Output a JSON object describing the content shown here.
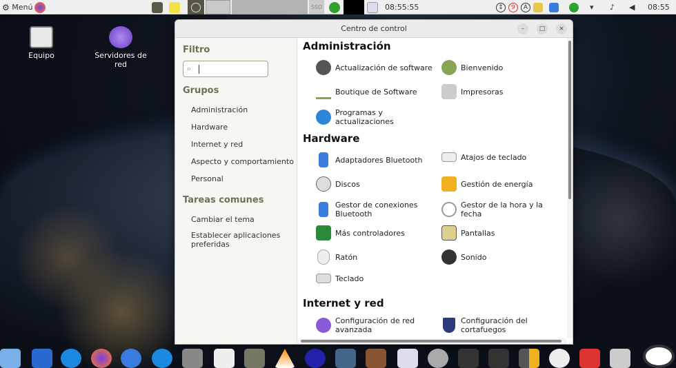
{
  "topbar": {
    "menu": "Menú",
    "clock_widget": "08:55:55",
    "clock": "08:55",
    "badge_count": "9",
    "disk_label": "SSD"
  },
  "desktop": {
    "icons": [
      {
        "label": "Equipo"
      },
      {
        "label": "Servidores de red"
      }
    ]
  },
  "window": {
    "title": "Centro de control",
    "minimize": "–",
    "maximize": "□",
    "close": "×"
  },
  "sidebar": {
    "filter_title": "Filtro",
    "search_value": "",
    "groups_title": "Grupos",
    "groups": [
      "Administración",
      "Hardware",
      "Internet y red",
      "Aspecto y comportamiento",
      "Personal"
    ],
    "tasks_title": "Tareas comunes",
    "tasks": [
      "Cambiar el tema",
      "Establecer aplicaciones preferidas"
    ]
  },
  "categories": [
    {
      "title": "Administración",
      "items": [
        "Actualización de software",
        "Bienvenido",
        "Boutique de Software",
        "Impresoras",
        "Programas y actualizaciones"
      ]
    },
    {
      "title": "Hardware",
      "items": [
        "Adaptadores Bluetooth",
        "Atajos de teclado",
        "Discos",
        "Gestión de energía",
        "Gestor de conexiones Bluetooth",
        "Gestor de la hora y la fecha",
        "Más controladores",
        "Pantallas",
        "Ratón",
        "Sonido",
        "Teclado"
      ]
    },
    {
      "title": "Internet y red",
      "items": [
        "Configuración de red avanzada",
        "Configuración del cortafuegos"
      ]
    }
  ],
  "colors": {
    "accent": "#87a556",
    "sidebar_heading": "#6f6f58"
  }
}
